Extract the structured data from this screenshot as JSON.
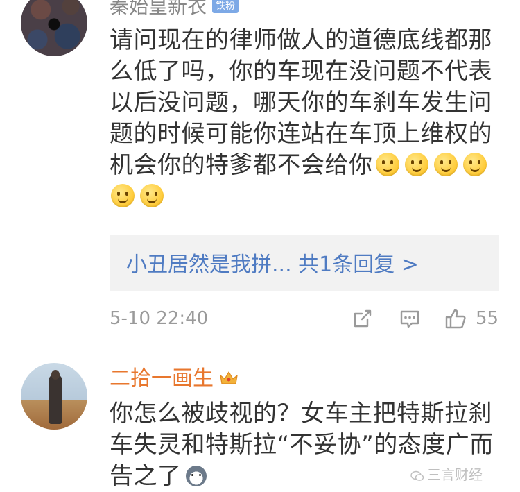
{
  "comments": [
    {
      "username": "秦始皇新衣",
      "badge": "铁粉",
      "lines": [
        "请问现在的律师做人的道德底线都那",
        "么低了吗，你的车现在没问题不代表",
        "以后没问题，哪天你的车刹车发生问",
        "题的时候可能你连站在车顶上维权的",
        "机会你的特爹都不会给你"
      ],
      "emoji": "smile-emoji",
      "reply_preview": "小丑居然是我拼... 共1条回复 >",
      "timestamp": "5-10 22:40",
      "like_count": "55"
    },
    {
      "username": "二拾一画生",
      "badge_icon": "crown-icon",
      "lines": [
        "你怎么被歧视的？女车主把特斯拉刹",
        "车失灵和特斯拉“不妥协”的态度广而",
        "告之了"
      ],
      "emoji": "husky-emoji"
    }
  ],
  "watermark": "三言财经",
  "colors": {
    "username_gray": "#888888",
    "username_vip": "#e8772e",
    "badge": "#7da9e6",
    "link": "#4f7bc2",
    "meta": "#9a9a9a",
    "reply_bg": "#f2f2f2"
  }
}
